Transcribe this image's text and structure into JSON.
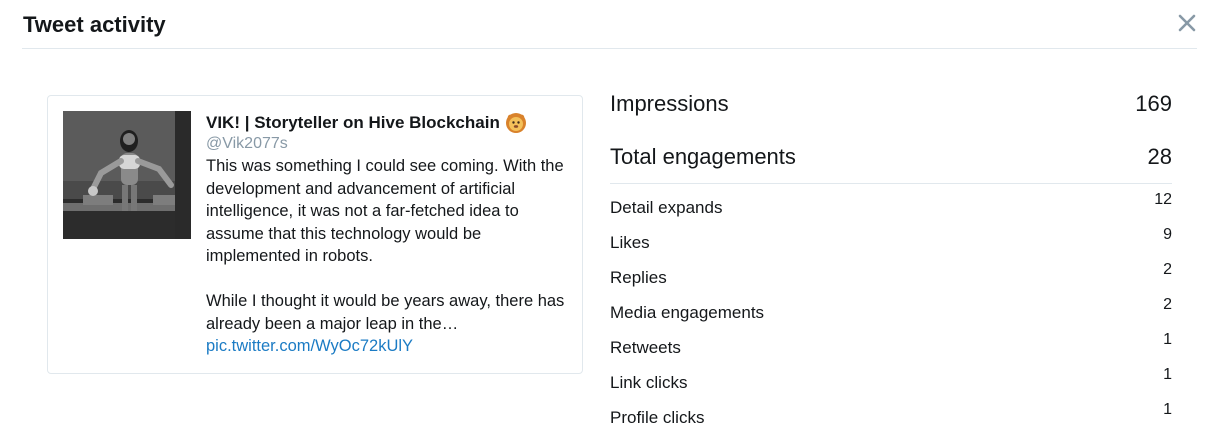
{
  "header": {
    "title": "Tweet activity",
    "close_icon": "close-icon"
  },
  "tweet": {
    "author_name": "VIK! | Storyteller on Hive Blockchain",
    "author_emoji": "lion-face-icon",
    "handle": "@Vik2077s",
    "paragraph1": "This was something I could see coming. With the development and advancement of artificial intelligence, it was not a far-fetched idea to assume that this technology would be implemented in robots.",
    "paragraph2": "While I thought it would be years away, there has already been a major leap in the…",
    "link": "pic.twitter.com/WyOc72kUlY"
  },
  "stats": {
    "impressions_label": "Impressions",
    "impressions_value": "169",
    "engagements_label": "Total engagements",
    "engagements_value": "28",
    "rows": [
      {
        "label": "Detail expands",
        "value": "12"
      },
      {
        "label": "Likes",
        "value": "9"
      },
      {
        "label": "Replies",
        "value": "2"
      },
      {
        "label": "Media engagements",
        "value": "2"
      },
      {
        "label": "Retweets",
        "value": "1"
      },
      {
        "label": "Link clicks",
        "value": "1"
      },
      {
        "label": "Profile clicks",
        "value": "1"
      }
    ]
  },
  "colors": {
    "text": "#14171a",
    "muted": "#8899a6",
    "link": "#1b7bc4",
    "divider": "#e1e8ed"
  }
}
